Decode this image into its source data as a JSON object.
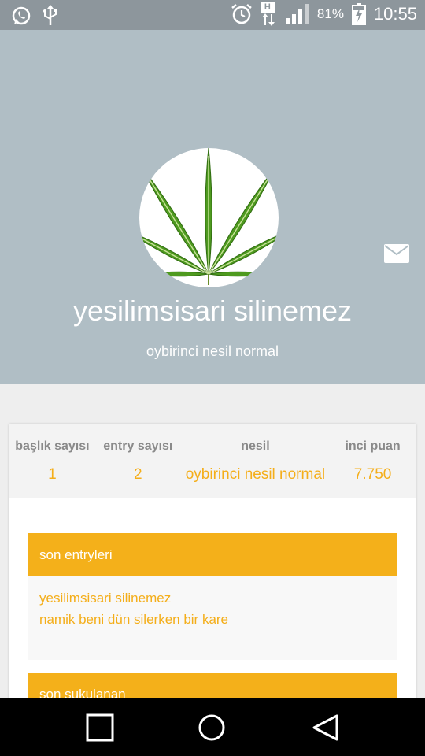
{
  "status_bar": {
    "battery_percent": "81%",
    "time": "10:55",
    "network_type": "H",
    "icons": [
      "whatsapp-icon",
      "usb-icon",
      "alarm-icon",
      "data-arrows-icon",
      "signal-icon",
      "battery-charging-icon"
    ]
  },
  "profile": {
    "username": "yesilimsisari silinemez",
    "generation": "oybirinci nesil normal",
    "avatar_icon": "cannabis-leaf-avatar",
    "message_icon": "envelope-icon"
  },
  "stats": [
    {
      "label": "başlık sayısı",
      "value": "1"
    },
    {
      "label": "entry sayısı",
      "value": "2"
    },
    {
      "label": "nesil",
      "value": "oybirinci nesil normal"
    },
    {
      "label": "inci puan",
      "value": "7.750"
    }
  ],
  "sections": {
    "recent_entries": {
      "title": "son entryleri",
      "items": [
        "yesilimsisari silinemez",
        "namik beni dün silerken bir kare"
      ]
    },
    "recent_votes": {
      "title": "son sukulanan"
    }
  },
  "nav_bar": {
    "buttons": [
      "recents-button",
      "home-button",
      "back-button"
    ]
  },
  "colors": {
    "accent": "#f4b01a",
    "header_bg": "#b0bec5",
    "status_bar_bg": "#8d969c"
  }
}
